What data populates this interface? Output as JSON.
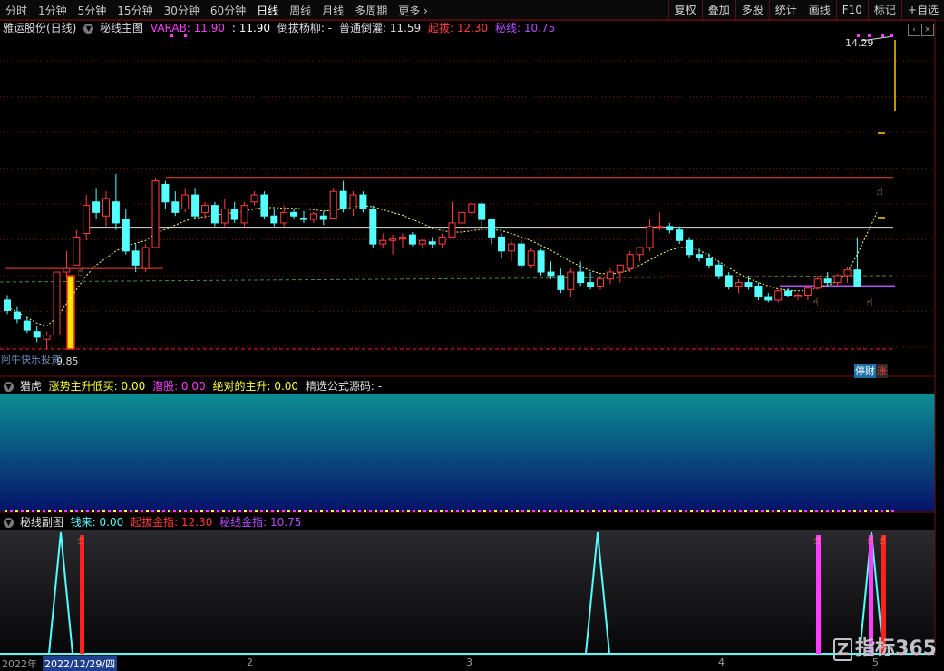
{
  "toolbar": {
    "timeframes": [
      "分时",
      "1分钟",
      "5分钟",
      "15分钟",
      "30分钟",
      "60分钟",
      "日线",
      "周线",
      "月线",
      "多周期",
      "更多 ›"
    ],
    "right_buttons": [
      "复权",
      "叠加",
      "多股",
      "统计",
      "画线",
      "F10",
      "标记",
      "+自选"
    ]
  },
  "main": {
    "stock_title": "雅运股份(日线)",
    "indicator_name": "秘线主图",
    "varab_label": "VARAB: 11.90",
    "varab_val2": ": 11.90",
    "daoba_label": "倒拔杨柳: -",
    "putong_label": "普通倒灌: 11.59",
    "qiba_label": "起拔: 12.30",
    "mixian_label": "秘线: 10.75",
    "price_high": "14.29",
    "price_low": "9.85",
    "bottom_text": "阿牛快乐投资",
    "tingcai_tag": "停财",
    "zhang_tag": "涨"
  },
  "sub1": {
    "name": "猎虎",
    "l1": "涨势主升低买: 0.00",
    "l2": "潜股: 0.00",
    "l3": "绝对的主升: 0.00",
    "l4": "精选公式源码: -"
  },
  "sub2": {
    "name": "秘线副图",
    "l1": "钱来: 0.00",
    "l2": "起拔金指: 12.30",
    "l3": "秘线金指: 10.75"
  },
  "date_axis": {
    "year": "2022年",
    "cursor_date": "2022/12/29/四",
    "m2": "2",
    "m3": "3",
    "m4": "4",
    "m5": "5"
  },
  "logo_text": "指标365",
  "colors": {
    "bull": "#ff3c3c",
    "bear": "#54ffff",
    "ma": "#ffff66",
    "accent_magenta": "#ff3cff",
    "grid_red": "#7a0f0f"
  },
  "chart_data": {
    "type": "candlestick",
    "candles": [
      [
        10.55,
        10.62,
        10.35,
        10.4
      ],
      [
        10.38,
        10.45,
        10.22,
        10.28
      ],
      [
        10.25,
        10.3,
        10.08,
        10.12
      ],
      [
        10.1,
        10.18,
        9.95,
        10.02
      ],
      [
        9.99,
        10.1,
        9.85,
        10.05
      ],
      [
        10.05,
        10.95,
        10.05,
        10.95
      ],
      [
        10.95,
        11.25,
        10.85,
        11.0
      ],
      [
        11.05,
        11.55,
        11.05,
        11.45
      ],
      [
        11.5,
        12.05,
        11.4,
        11.9
      ],
      [
        11.95,
        12.15,
        11.7,
        11.8
      ],
      [
        11.75,
        12.1,
        11.6,
        12.0
      ],
      [
        11.95,
        12.35,
        11.55,
        11.65
      ],
      [
        11.7,
        11.85,
        11.2,
        11.25
      ],
      [
        11.25,
        11.35,
        10.95,
        11.05
      ],
      [
        11.0,
        11.35,
        10.95,
        11.3
      ],
      [
        11.3,
        12.3,
        11.3,
        12.25
      ],
      [
        12.2,
        12.25,
        11.85,
        11.95
      ],
      [
        11.95,
        12.1,
        11.75,
        11.8
      ],
      [
        11.85,
        12.15,
        11.8,
        12.05
      ],
      [
        12.05,
        12.15,
        11.7,
        11.75
      ],
      [
        11.8,
        11.95,
        11.7,
        11.9
      ],
      [
        11.9,
        11.95,
        11.6,
        11.65
      ],
      [
        11.65,
        12.0,
        11.6,
        11.85
      ],
      [
        11.85,
        11.95,
        11.65,
        11.7
      ],
      [
        11.65,
        11.95,
        11.6,
        11.9
      ],
      [
        11.95,
        12.1,
        11.9,
        12.05
      ],
      [
        12.05,
        12.1,
        11.7,
        11.75
      ],
      [
        11.75,
        11.85,
        11.6,
        11.65
      ],
      [
        11.65,
        11.9,
        11.6,
        11.8
      ],
      [
        11.8,
        11.85,
        11.7,
        11.75
      ],
      [
        11.72,
        11.82,
        11.65,
        11.7
      ],
      [
        11.7,
        11.8,
        11.65,
        11.78
      ],
      [
        11.75,
        11.82,
        11.62,
        11.7
      ],
      [
        11.72,
        12.15,
        11.7,
        12.1
      ],
      [
        12.1,
        12.25,
        11.8,
        11.85
      ],
      [
        11.85,
        12.1,
        11.75,
        12.05
      ],
      [
        12.05,
        12.1,
        11.8,
        11.85
      ],
      [
        11.85,
        11.9,
        11.3,
        11.35
      ],
      [
        11.35,
        11.5,
        11.3,
        11.4
      ],
      [
        11.4,
        11.48,
        11.2,
        11.42
      ],
      [
        11.42,
        11.5,
        11.3,
        11.45
      ],
      [
        11.48,
        11.52,
        11.32,
        11.35
      ],
      [
        11.35,
        11.42,
        11.3,
        11.4
      ],
      [
        11.38,
        11.45,
        11.3,
        11.35
      ],
      [
        11.35,
        11.5,
        11.3,
        11.45
      ],
      [
        11.45,
        11.95,
        11.45,
        11.65
      ],
      [
        11.65,
        11.85,
        11.5,
        11.8
      ],
      [
        11.8,
        11.95,
        11.75,
        11.92
      ],
      [
        11.92,
        11.95,
        11.55,
        11.7
      ],
      [
        11.7,
        11.72,
        11.35,
        11.45
      ],
      [
        11.45,
        11.5,
        11.15,
        11.25
      ],
      [
        11.25,
        11.4,
        11.1,
        11.35
      ],
      [
        11.35,
        11.4,
        11.0,
        11.05
      ],
      [
        11.05,
        11.3,
        11.0,
        11.25
      ],
      [
        11.25,
        11.28,
        10.9,
        10.95
      ],
      [
        10.95,
        11.1,
        10.85,
        10.9
      ],
      [
        10.9,
        11.0,
        10.65,
        10.7
      ],
      [
        10.7,
        11.0,
        10.6,
        10.95
      ],
      [
        10.95,
        11.1,
        10.75,
        10.8
      ],
      [
        10.8,
        10.95,
        10.7,
        10.75
      ],
      [
        10.75,
        10.9,
        10.7,
        10.85
      ],
      [
        10.85,
        11.0,
        10.78,
        10.95
      ],
      [
        10.95,
        11.05,
        10.8,
        11.05
      ],
      [
        11.0,
        11.25,
        10.95,
        11.2
      ],
      [
        11.2,
        11.3,
        11.1,
        11.3
      ],
      [
        11.3,
        11.7,
        11.25,
        11.6
      ],
      [
        11.6,
        11.8,
        11.55,
        11.6
      ],
      [
        11.6,
        11.65,
        11.5,
        11.55
      ],
      [
        11.55,
        11.6,
        11.35,
        11.4
      ],
      [
        11.4,
        11.45,
        11.15,
        11.2
      ],
      [
        11.2,
        11.3,
        11.1,
        11.15
      ],
      [
        11.15,
        11.22,
        11.0,
        11.05
      ],
      [
        11.05,
        11.1,
        10.85,
        10.9
      ],
      [
        10.9,
        10.95,
        10.7,
        10.75
      ],
      [
        10.75,
        10.85,
        10.65,
        10.8
      ],
      [
        10.8,
        10.9,
        10.7,
        10.75
      ],
      [
        10.75,
        10.8,
        10.55,
        10.6
      ],
      [
        10.6,
        10.65,
        10.52,
        10.55
      ],
      [
        10.55,
        10.7,
        10.52,
        10.68
      ],
      [
        10.68,
        10.72,
        10.6,
        10.62
      ],
      [
        10.6,
        10.65,
        10.55,
        10.62
      ],
      [
        10.62,
        10.75,
        10.55,
        10.72
      ],
      [
        10.72,
        10.9,
        10.7,
        10.85
      ],
      [
        10.85,
        10.95,
        10.75,
        10.8
      ],
      [
        10.8,
        10.92,
        10.75,
        10.9
      ],
      [
        10.9,
        11.02,
        10.8,
        10.98
      ],
      [
        10.98,
        11.45,
        10.75,
        10.75
      ]
    ],
    "ma": [
      10.45,
      10.38,
      10.3,
      10.22,
      10.18,
      10.3,
      10.5,
      10.7,
      10.9,
      11.05,
      11.15,
      11.25,
      11.32,
      11.36,
      11.4,
      11.5,
      11.56,
      11.62,
      11.68,
      11.72,
      11.74,
      11.76,
      11.78,
      11.8,
      11.82,
      11.85,
      11.87,
      11.87,
      11.86,
      11.86,
      11.85,
      11.84,
      11.82,
      11.83,
      11.85,
      11.88,
      11.9,
      11.88,
      11.84,
      11.8,
      11.76,
      11.7,
      11.64,
      11.58,
      11.54,
      11.52,
      11.52,
      11.54,
      11.56,
      11.56,
      11.54,
      11.5,
      11.45,
      11.4,
      11.33,
      11.26,
      11.18,
      11.1,
      11.03,
      10.97,
      10.93,
      10.92,
      10.94,
      10.98,
      11.05,
      11.12,
      11.2,
      11.26,
      11.3,
      11.3,
      11.26,
      11.19,
      11.1,
      11.01,
      10.93,
      10.86,
      10.8,
      10.75,
      10.71,
      10.69,
      10.68,
      10.69,
      10.72,
      10.76,
      10.82,
      10.95,
      11.2,
      11.5,
      11.8
    ],
    "horizontal_levels": [
      {
        "name": "qiba",
        "value": 12.3
      },
      {
        "name": "varab",
        "value": 11.59
      },
      {
        "name": "mixian",
        "value": 10.75
      },
      {
        "name": "low",
        "value": 9.85
      }
    ],
    "price_range": [
      9.85,
      14.29
    ]
  }
}
